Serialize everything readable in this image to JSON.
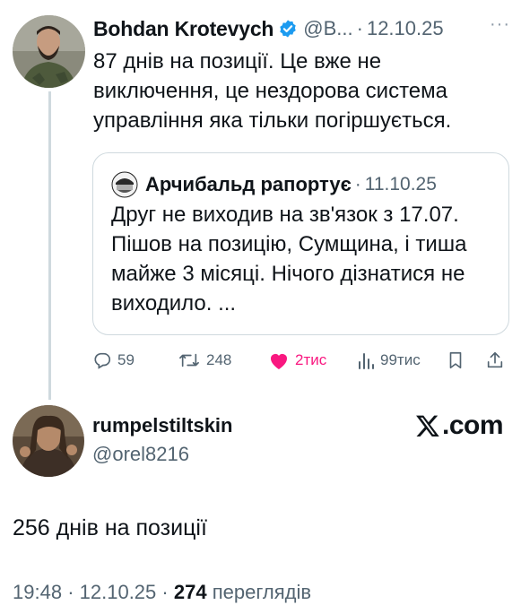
{
  "tweet": {
    "author_name": "Bohdan Krotevych",
    "handle": "@B...",
    "separator": "·",
    "date": "12.10.25",
    "text": "87 днів на позиції. Це вже не виключення, це нездорова система управління яка тільки погіршується."
  },
  "quote": {
    "author_name": "Арчибальд рапортує",
    "separator": "·",
    "date": "11.10.25",
    "text": "Друг не виходив на зв'язок з 17.07. Пішов на позицію, Сумщина, і тиша майже 3 місяці. Нічого дізнатися не виходило. ..."
  },
  "actions": {
    "replies": "59",
    "retweets": "248",
    "likes": "2тис",
    "views": "99тис",
    "like_color": "#f91880"
  },
  "reply": {
    "author_name": "rumpelstiltskin",
    "handle": "@orel8216",
    "text": "256 днів на позиції",
    "time": "19:48",
    "separator": "·",
    "date": "12.10.25",
    "views_count": "274",
    "views_label": "переглядів"
  },
  "watermark": {
    "suffix": ".com"
  },
  "colors": {
    "text": "#0f1419",
    "secondary": "#536471",
    "border": "#cfd9de",
    "verified": "#1d9bf0"
  },
  "icons": [
    "more-icon",
    "verified-icon",
    "reply-icon",
    "retweet-icon",
    "heart-icon",
    "views-icon",
    "bookmark-icon",
    "share-icon",
    "x-logo-icon"
  ]
}
